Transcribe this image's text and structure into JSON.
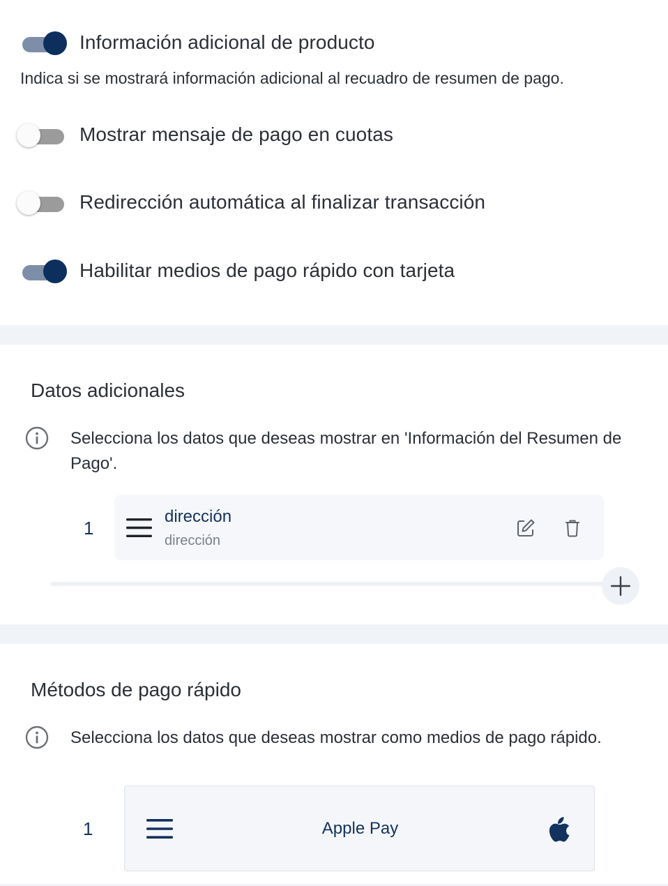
{
  "settings": {
    "toggles": [
      {
        "label": "Información adicional de producto",
        "state": "on"
      },
      {
        "label": "Mostrar mensaje de pago en cuotas",
        "state": "off"
      },
      {
        "label": "Redirección automática al finalizar transacción",
        "state": "off"
      },
      {
        "label": "Habilitar medios de pago rápido con tarjeta",
        "state": "on"
      }
    ],
    "helper_text": "Indica si se mostrará información adicional al recuadro de resumen de pago."
  },
  "additional_data": {
    "title": "Datos adicionales",
    "info_text": "Selecciona los datos que deseas mostrar en 'Información del Resumen de Pago'.",
    "items": [
      {
        "index": "1",
        "title": "dirección",
        "subtitle": "dirección"
      }
    ],
    "icons": {
      "info": "info-circle-icon",
      "drag": "menu-icon",
      "edit": "edit-icon",
      "delete": "trash-icon",
      "add": "plus-icon"
    }
  },
  "quick_payment": {
    "title": "Métodos de pago rápido",
    "info_text": "Selecciona los datos que deseas mostrar como medios de pago rápido.",
    "methods": [
      {
        "index": "1",
        "name": "Apple Pay",
        "icon": "apple-icon"
      }
    ]
  },
  "colors": {
    "toggle_on_knob": "#0d2f5e",
    "toggle_on_track": "#7d8ea8",
    "toggle_off_track": "#9b9b9b",
    "accent_text": "#14325e",
    "band": "#f0f3f7"
  }
}
